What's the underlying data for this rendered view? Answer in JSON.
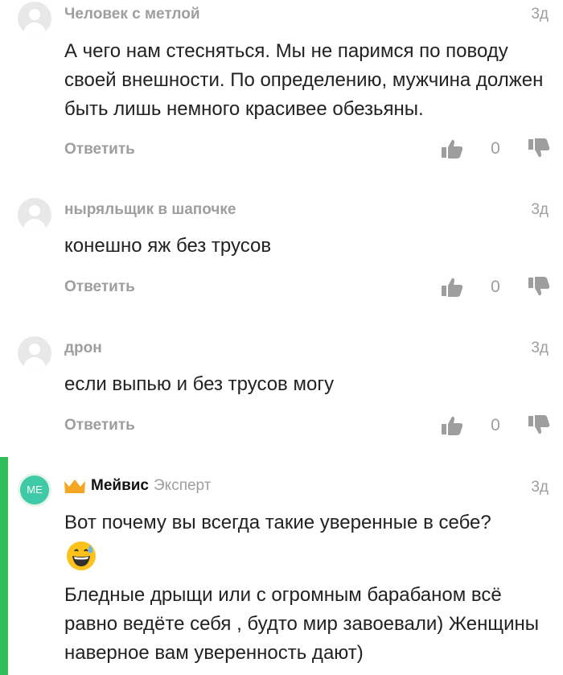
{
  "comments": [
    {
      "author": "Человек с метлой",
      "time": "3д",
      "text": "А чего нам стесняться. Мы не паримся по поводу своей внешности. По определению, мужчина должен быть лишь немного красивее обезьяны.",
      "reply_label": "Ответить",
      "score": "0"
    },
    {
      "author": "ныряльщик в шапочке",
      "time": "3д",
      "text": "конешно яж без трусов",
      "reply_label": "Ответить",
      "score": "0"
    },
    {
      "author": "дрон",
      "time": "3д",
      "text": "если выпью и без трусов могу",
      "reply_label": "Ответить",
      "score": "0"
    },
    {
      "author": "Мейвис",
      "role": "Эксперт",
      "avatar_initials": "МЕ",
      "time": "3д",
      "text_line1": "Вот почему вы всегда такие уверенные в себе?",
      "text_line2": "Бледные дрыщи или с огромным барабаном всё равно ведёте себя , будто мир завоевали) Женщины наверное вам уверенность дают)"
    }
  ],
  "icons": {
    "like": "thumbs-up-icon",
    "dislike": "thumbs-down-icon",
    "crown": "crown-icon",
    "emoji": "grinning-sweat-emoji"
  },
  "colors": {
    "accent_green": "#2ebd59",
    "muted": "#9e9e9e",
    "crown": "#f5a623"
  }
}
